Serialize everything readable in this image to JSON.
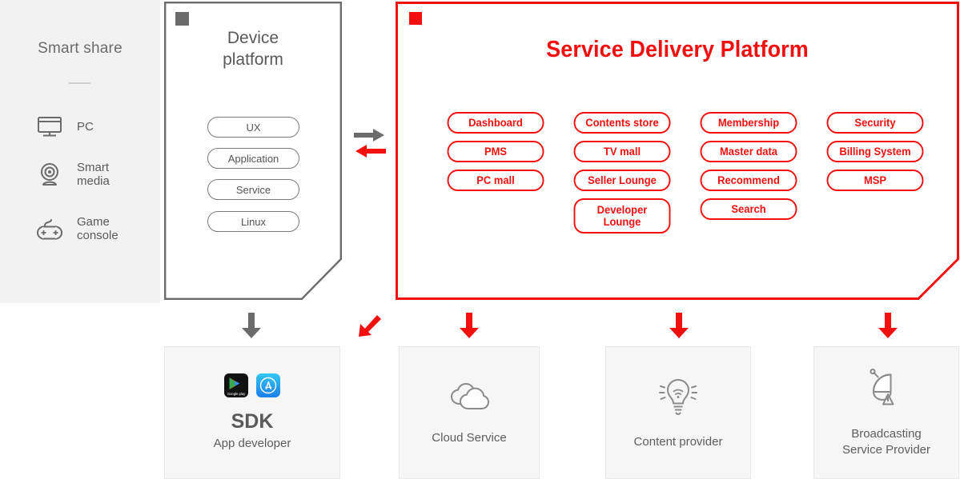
{
  "colors": {
    "brand_red": "#f40f0f",
    "gray_text": "#5a5a5a",
    "panel_gray": "#f2f2f2",
    "box_gray": "#f6f6f6"
  },
  "smart_share": {
    "title": "Smart share",
    "devices": [
      {
        "label": "PC",
        "icon": "monitor-icon"
      },
      {
        "label": "Smart\nmedia",
        "icon": "webcam-icon"
      },
      {
        "label": "Game\nconsole",
        "icon": "gamepad-icon"
      }
    ]
  },
  "device_platform": {
    "title": "Device\nplatform",
    "marker": "square-marker-icon",
    "layers": [
      {
        "label": "UX"
      },
      {
        "label": "Application"
      },
      {
        "label": "Service"
      },
      {
        "label": "Linux"
      }
    ]
  },
  "exchange": {
    "right_arrow": "arrow-right-gray-icon",
    "left_arrow": "arrow-left-red-icon"
  },
  "service_delivery_platform": {
    "title": "Service Delivery Platform",
    "marker": "square-marker-red-icon",
    "columns": [
      {
        "name": "commerce",
        "items": [
          {
            "label": "Dashboard"
          },
          {
            "label": "PMS"
          },
          {
            "label": "PC mall"
          }
        ]
      },
      {
        "name": "store",
        "items": [
          {
            "label": "Contents store"
          },
          {
            "label": "TV mall"
          },
          {
            "label": "Seller Lounge"
          },
          {
            "label": "Developer\nLounge",
            "two_line": true
          }
        ]
      },
      {
        "name": "user",
        "items": [
          {
            "label": "Membership"
          },
          {
            "label": "Master data"
          },
          {
            "label": "Recommend"
          },
          {
            "label": "Search"
          }
        ]
      },
      {
        "name": "platform",
        "items": [
          {
            "label": "Security"
          },
          {
            "label": "Billing System"
          },
          {
            "label": "MSP"
          }
        ]
      }
    ]
  },
  "consumers": [
    {
      "key": "sdk",
      "title": "SDK",
      "subtitle": "App developer",
      "arrow": "arrow-down-gray-icon",
      "icons": [
        "google-play-icon",
        "app-store-icon"
      ]
    },
    {
      "key": "cloud",
      "label": "Cloud Service",
      "arrow": "arrow-down-red-icon",
      "icon": "cloud-icon"
    },
    {
      "key": "content",
      "label": "Content provider",
      "arrow": "arrow-down-red-icon",
      "icon": "lightbulb-wifi-icon"
    },
    {
      "key": "broadcast",
      "label": "Broadcasting\nService Provider",
      "arrow": "arrow-down-red-icon",
      "icon": "satellite-dish-icon"
    }
  ],
  "diagonal_arrow": "arrow-down-left-red-icon"
}
